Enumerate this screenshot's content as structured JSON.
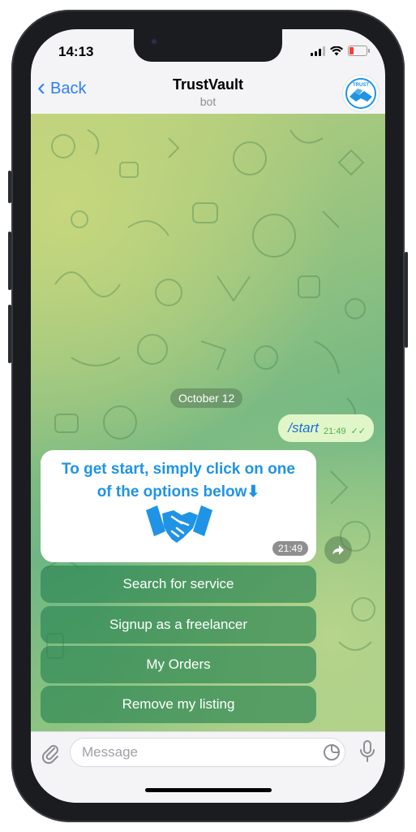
{
  "status_bar": {
    "time": "14:13"
  },
  "header": {
    "back_label": "Back",
    "title": "TrustVault",
    "subtitle": "bot",
    "avatar_text": "TRUST"
  },
  "chat": {
    "date_label": "October 12",
    "outgoing": {
      "text": "/start",
      "time": "21:49"
    },
    "incoming": {
      "text_line1": "To get start, simply click on one",
      "text_line2": "of the options below⬇",
      "time": "21:49"
    },
    "keyboard_buttons": [
      {
        "label": "Search for service"
      },
      {
        "label": "Signup as a freelancer"
      },
      {
        "label": "My Orders"
      },
      {
        "label": "Remove my listing"
      }
    ]
  },
  "composer": {
    "placeholder": "Message"
  },
  "colors": {
    "accent": "#2f7ef6",
    "bot_text": "#1f93e6",
    "keyboard_button": "#2d8a52",
    "outgoing_bubble": "#e1f6c8"
  }
}
